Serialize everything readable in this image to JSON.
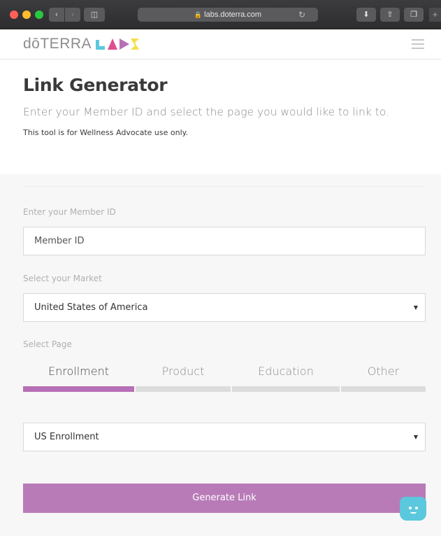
{
  "browser": {
    "url": "labs.doterra.com"
  },
  "header": {
    "logo_text": "dōTERRA",
    "logo_mark": "LABS",
    "logo_colors": [
      "#5bc8dd",
      "#e04e8f",
      "#b76fb5",
      "#f4e04d"
    ]
  },
  "hero": {
    "title": "Link Generator",
    "subtitle": "Enter your Member ID and select the page you would like to link to.",
    "disclaimer": "This tool is for Wellness Advocate use only."
  },
  "form": {
    "member_id_label": "Enter your Member ID",
    "member_id_placeholder": "Member ID",
    "market_label": "Select your Market",
    "market_value": "United States of America",
    "page_label": "Select Page",
    "tabs": [
      {
        "label": "Enrollment",
        "active": true
      },
      {
        "label": "Product",
        "active": false
      },
      {
        "label": "Education",
        "active": false
      },
      {
        "label": "Other",
        "active": false
      }
    ],
    "page_value": "US Enrollment",
    "generate_label": "Generate Link"
  },
  "colors": {
    "accent": "#b76fb5",
    "button": "#b87bb8",
    "chat": "#5bc8dd"
  }
}
